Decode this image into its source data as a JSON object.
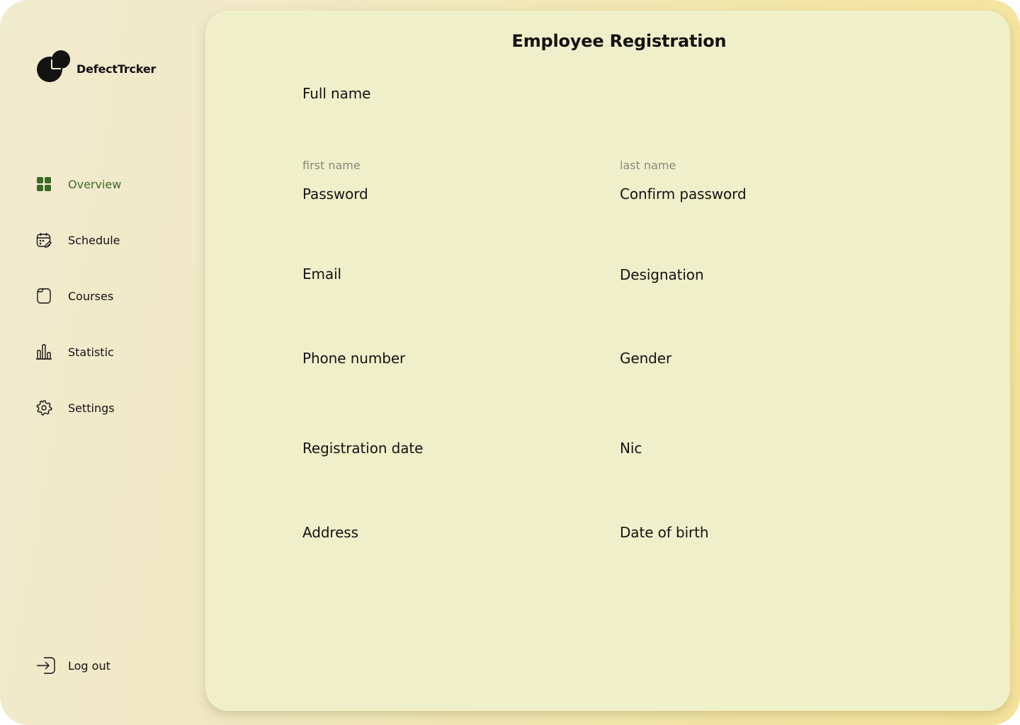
{
  "brand": {
    "name": "DefectTrcker"
  },
  "sidebar": {
    "items": [
      {
        "label": "Overview",
        "icon": "grid-icon",
        "active": true
      },
      {
        "label": "Schedule",
        "icon": "calendar-edit-icon",
        "active": false
      },
      {
        "label": "Courses",
        "icon": "folder-icon",
        "active": false
      },
      {
        "label": "Statistic",
        "icon": "bar-chart-icon",
        "active": false
      },
      {
        "label": "Settings",
        "icon": "gear-icon",
        "active": false
      }
    ],
    "logout": {
      "label": "Log out",
      "icon": "logout-icon"
    }
  },
  "form": {
    "title": "Employee Registration",
    "full_name": {
      "label": "Full name",
      "first_placeholder": "first name",
      "last_placeholder": "last name"
    },
    "password_label": "Password",
    "confirm_password_label": "Confirm password",
    "email_label": "Email",
    "designation_label": "Designation",
    "phone_label": "Phone number",
    "gender_label": "Gender",
    "registration_date_label": "Registration date",
    "nic_label": "Nic",
    "address_label": "Address",
    "dob_label": "Date of birth"
  },
  "colors": {
    "accent_green": "#3a6a26",
    "card_bg": "#eff0c9",
    "hint_gray": "#8a8a7a"
  }
}
